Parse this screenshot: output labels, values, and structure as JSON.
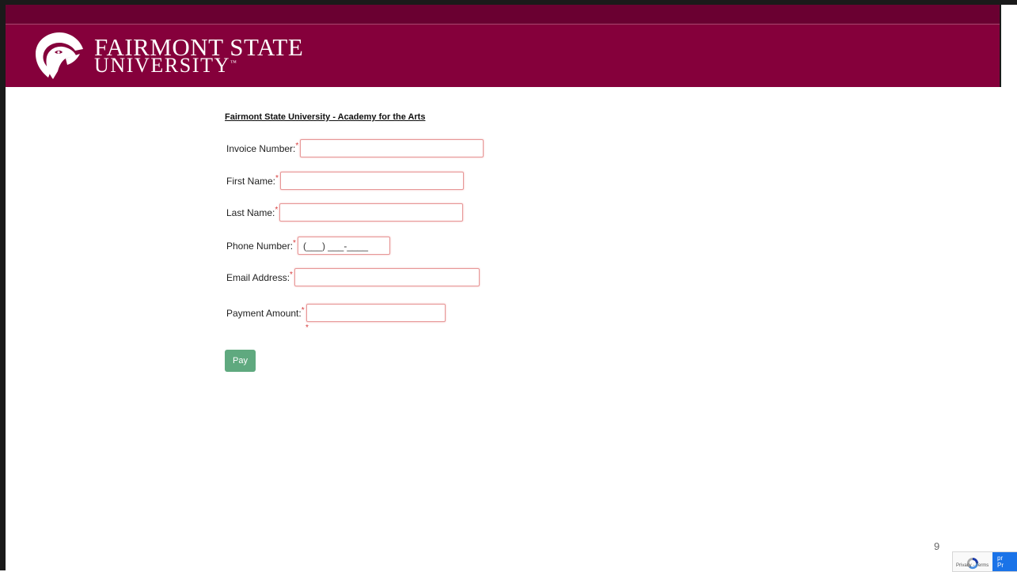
{
  "header": {
    "logo_line1": "FAIRMONT STATE",
    "logo_line2": "UNIVERSITY",
    "logo_tm": "™",
    "logo_icon": "falcon-head-icon",
    "colors": {
      "header_bg": "#85003b",
      "top_strip": "#6a0031",
      "pay_button": "#5fa97f",
      "required": "#d63a3a"
    }
  },
  "form": {
    "title": "Fairmont State University - Academy for the Arts",
    "required_mark": "*",
    "fields": {
      "invoice": {
        "label": "Invoice Number:",
        "value": ""
      },
      "first_name": {
        "label": "First Name:",
        "value": ""
      },
      "last_name": {
        "label": "Last Name:",
        "value": ""
      },
      "phone": {
        "label": "Phone Number:",
        "placeholder": "(___) ___-____",
        "value": ""
      },
      "email": {
        "label": "Email Address:",
        "value": ""
      },
      "amount": {
        "label": "Payment Amount:",
        "value": ""
      }
    },
    "pay_label": "Pay"
  },
  "page_number": "9",
  "recaptcha": {
    "icon": "recaptcha-icon",
    "terms": "Privacy - Terms",
    "side_line1": "pr",
    "side_line2": "Pr"
  }
}
